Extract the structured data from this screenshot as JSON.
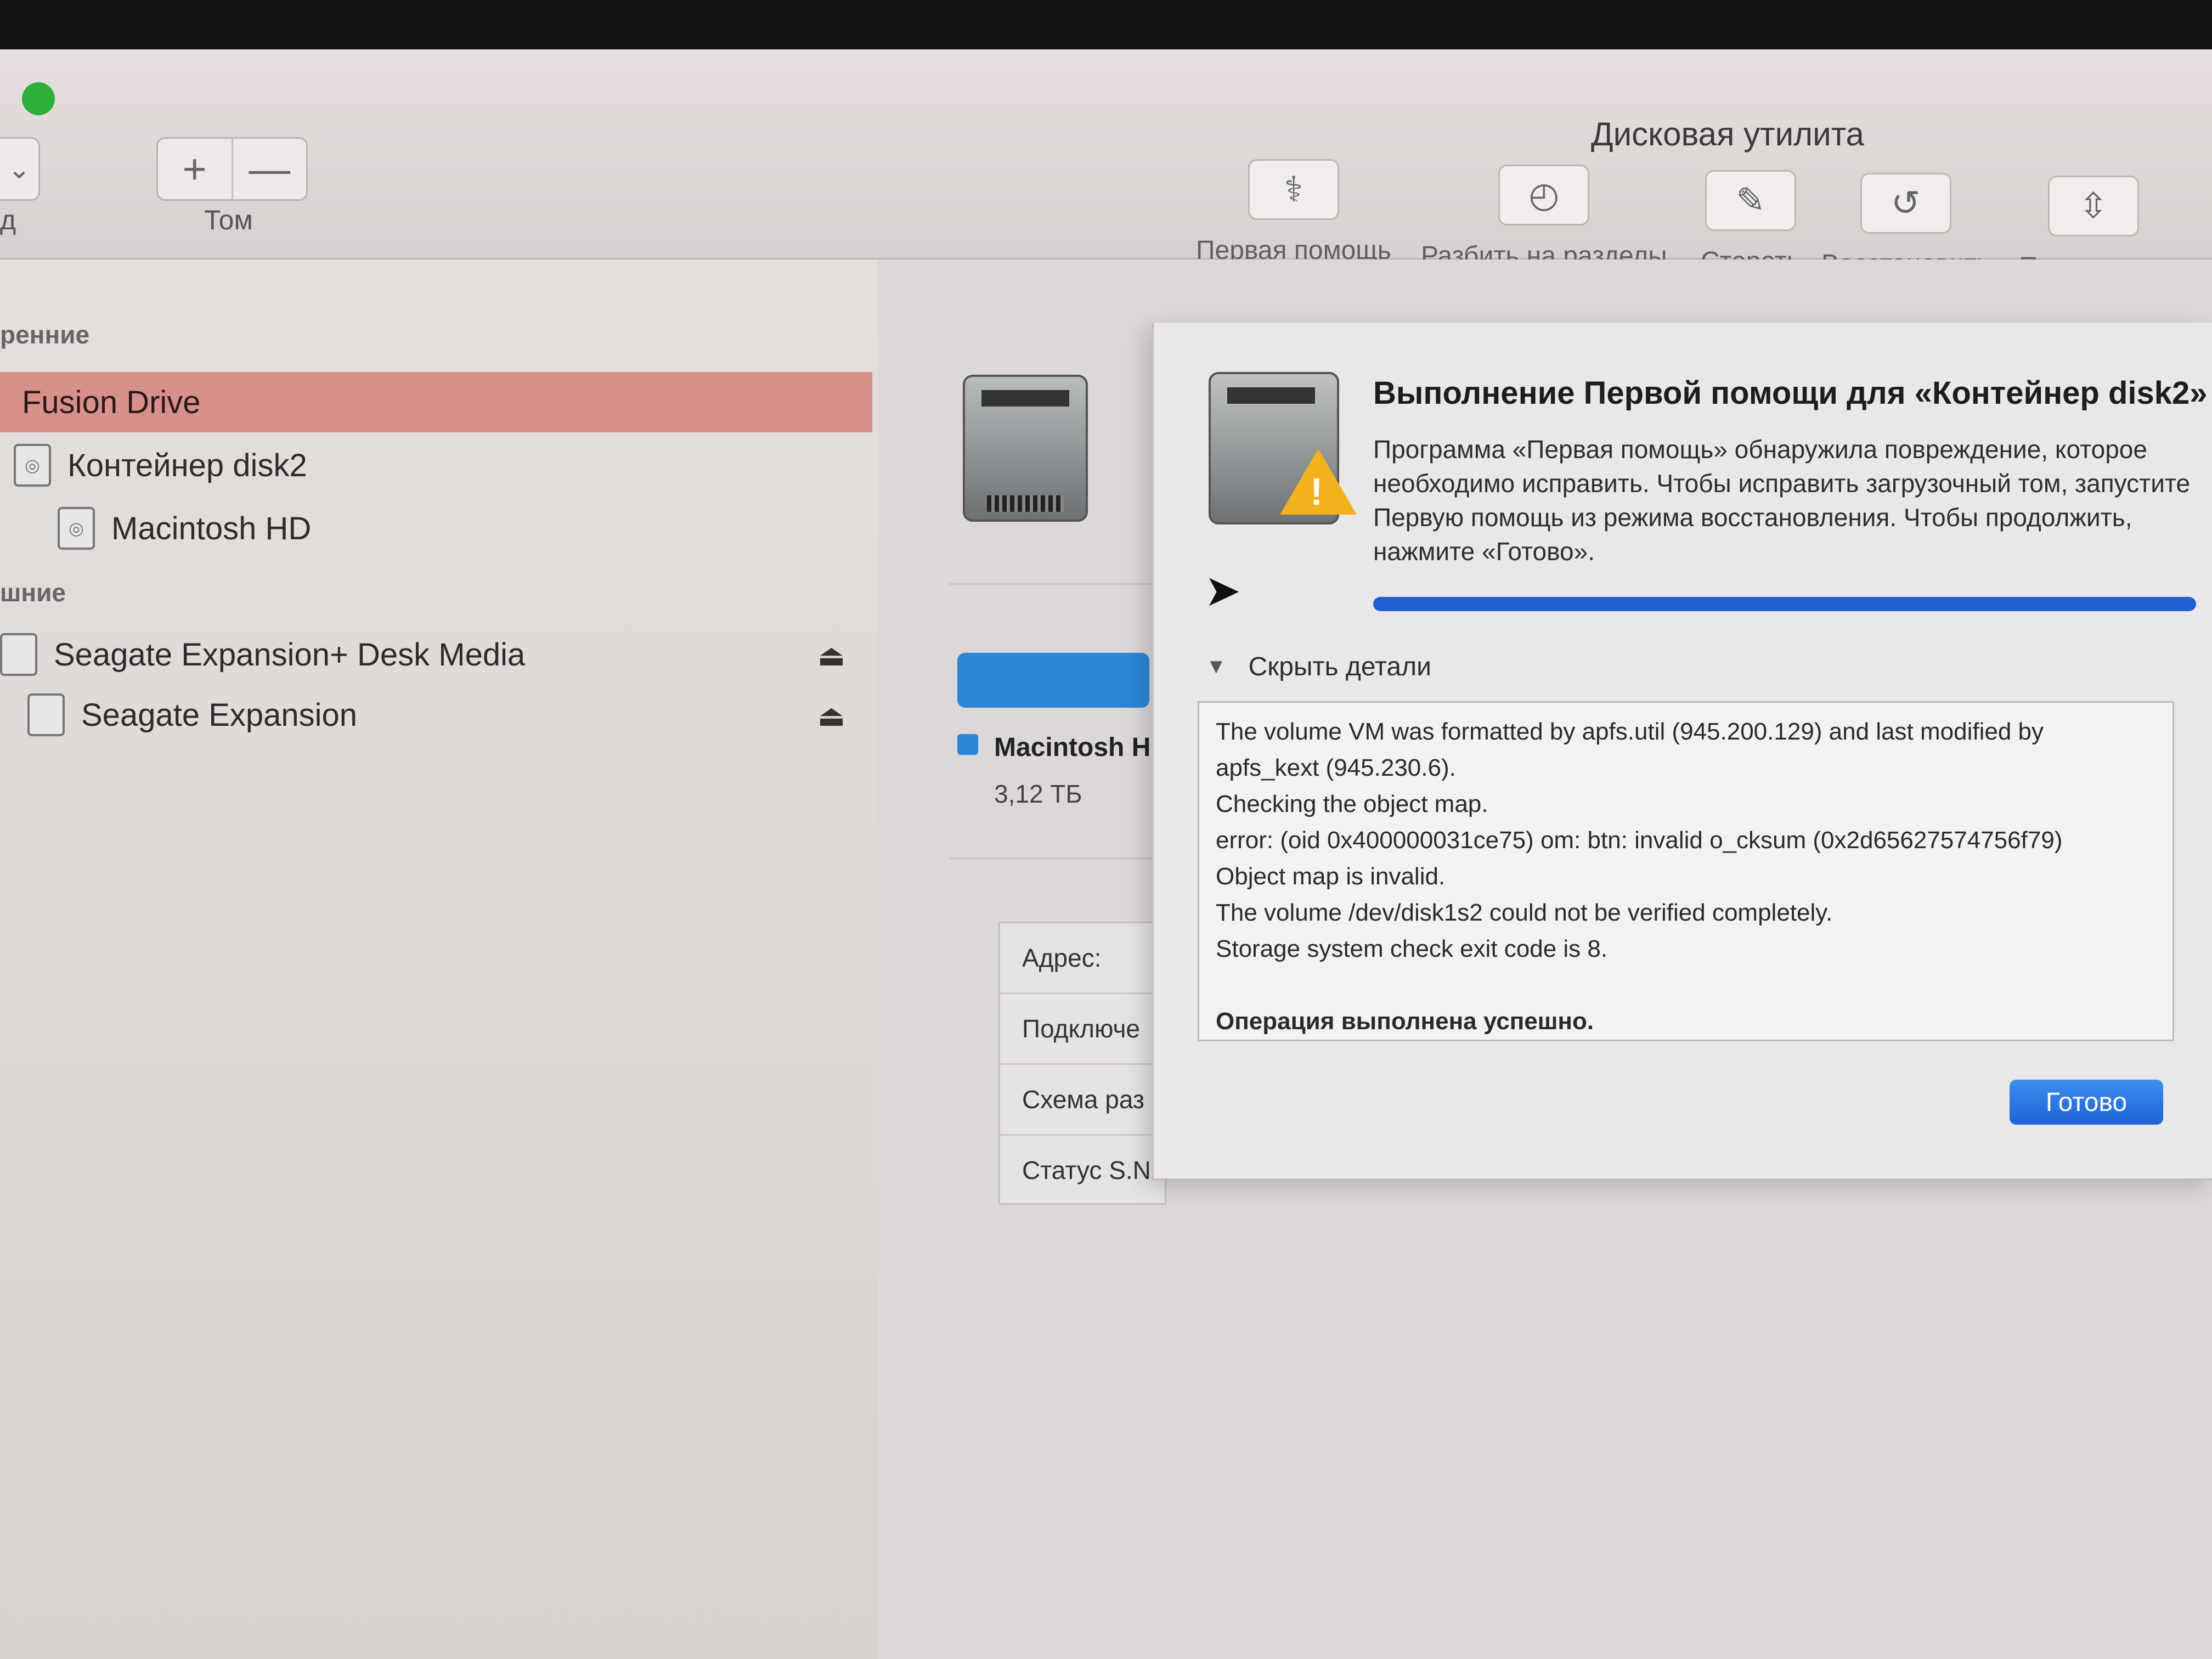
{
  "window": {
    "title": "Дисковая утилита"
  },
  "toolbar": {
    "left_clipped_label": "д",
    "volume_label": "Том",
    "volume_buttons": [
      "+",
      "—"
    ],
    "buttons": [
      {
        "label": "Первая помощь",
        "icon": "stethoscope-icon"
      },
      {
        "label": "Разбить на разделы",
        "icon": "pie-chart-icon"
      },
      {
        "label": "Стереть",
        "icon": "erase-disk-icon"
      },
      {
        "label": "Восстановить",
        "icon": "restore-icon"
      },
      {
        "label": "Подключить",
        "icon": "mount-icon"
      }
    ]
  },
  "sidebar": {
    "internal_header": "ренние",
    "external_header": "шние",
    "internal_items": [
      {
        "label": "Fusion Drive",
        "selected": true
      },
      {
        "label": "Контейнер disk2",
        "selected": false
      },
      {
        "label": "Macintosh HD",
        "selected": false
      }
    ],
    "external_items": [
      {
        "label": "Seagate Expansion+ Desk Media",
        "eject": "⏏"
      },
      {
        "label": "Seagate Expansion",
        "eject": "⏏"
      }
    ]
  },
  "main": {
    "volume_name": "Macintosh H",
    "volume_size": "3,12 ТБ",
    "info_rows": [
      "Адрес:",
      "Подключе",
      "Схема раз",
      "Статус S.N"
    ]
  },
  "sheet": {
    "title": "Выполнение Первой помощи для «Контейнер disk2»",
    "message": "Программа «Первая помощь» обнаружила повреждение, которое необходимо исправить. Чтобы исправить загрузочный том, запустите Первую помощь из режима восстановления. Чтобы продолжить, нажмите «Готово».",
    "progress_fraction": 1.0,
    "disclosure_label": "Скрыть детали",
    "log_lines": [
      "The volume VM was formatted by apfs.util (945.200.129) and last modified by",
      "apfs_kext (945.230.6).",
      "Checking the object map.",
      "error: (oid 0x400000031ce75) om: btn: invalid o_cksum (0x2d65627574756f79)",
      "Object map is invalid.",
      "The volume /dev/disk1s2 could not be verified completely.",
      "Storage system check exit code is 8."
    ],
    "result": "Операция выполнена успешно.",
    "done_button": "Готово"
  },
  "colors": {
    "selection": "#d8908a",
    "accent": "#1f5fd0",
    "usage": "#2c86d8",
    "warning": "#f2b21c"
  }
}
